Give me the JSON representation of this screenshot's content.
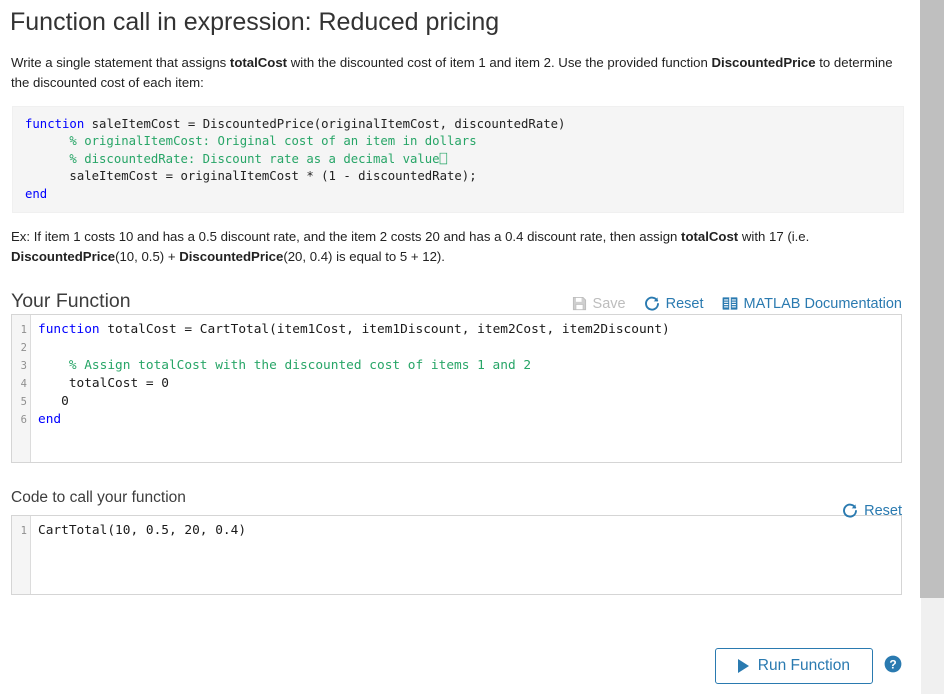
{
  "page": {
    "title": "Function call in expression: Reduced pricing"
  },
  "prompt": {
    "part1": "Write a single statement that assigns ",
    "bold1": "totalCost",
    "part2": " with the discounted cost of item 1 and item 2. Use the provided function ",
    "bold2": "DiscountedPrice",
    "part3": " to determine the discounted cost of each item:"
  },
  "given_code": {
    "lines": [
      "function saleItemCost = DiscountedPrice(originalItemCost, discountedRate)",
      "      % originalItemCost: Original cost of an item in dollars",
      "      % discountedRate: Discount rate as a decimal value⎕",
      "      saleItemCost = originalItemCost * (1 - discountedRate);",
      "end"
    ]
  },
  "example": {
    "part1": "Ex: If item 1 costs 10 and has a 0.5 discount rate, and the item 2 costs 20 and has a 0.4 discount rate, then assign ",
    "bold1": "totalCost",
    "part2": " with 17 (i.e. ",
    "bold2": "DiscountedPrice",
    "part3": "(10, 0.5) + ",
    "bold3": "DiscountedPrice",
    "part4": "(20, 0.4) is equal to 5 + 12)."
  },
  "your_function": {
    "heading": "Your Function",
    "toolbar": {
      "save_label": "Save",
      "save_icon": "floppy-disk-icon",
      "save_disabled": true,
      "reset_label": "Reset",
      "reset_icon": "refresh-icon",
      "docs_label": "MATLAB Documentation",
      "docs_icon": "book-icon"
    },
    "editor": {
      "line_numbers": [
        "1",
        "2",
        "3",
        "4",
        "5",
        "6"
      ],
      "lines": [
        "function totalCost = CartTotal(item1Cost, item1Discount, item2Cost, item2Discount)",
        "",
        "    % Assign totalCost with the discounted cost of items 1 and 2",
        "    totalCost = 0",
        "   0",
        "end"
      ]
    }
  },
  "code_to_call": {
    "heading": "Code to call your function",
    "toolbar": {
      "reset_label": "Reset",
      "reset_icon": "refresh-icon"
    },
    "editor": {
      "line_numbers": [
        "1"
      ],
      "lines": [
        "CartTotal(10, 0.5, 20, 0.4)"
      ]
    }
  },
  "footer": {
    "run_label": "Run Function",
    "run_icon": "play-icon",
    "help_icon": "question-circle-icon"
  },
  "colors": {
    "accent_blue": "#2a7ab0",
    "keyword_blue": "#0000ff",
    "comment_green": "#27a567",
    "disabled_grey": "#bdbdbd",
    "scrollbar_thumb": "#bfbfbf"
  },
  "scrollbar": {
    "thumb_top": 0,
    "thumb_height": 598
  }
}
